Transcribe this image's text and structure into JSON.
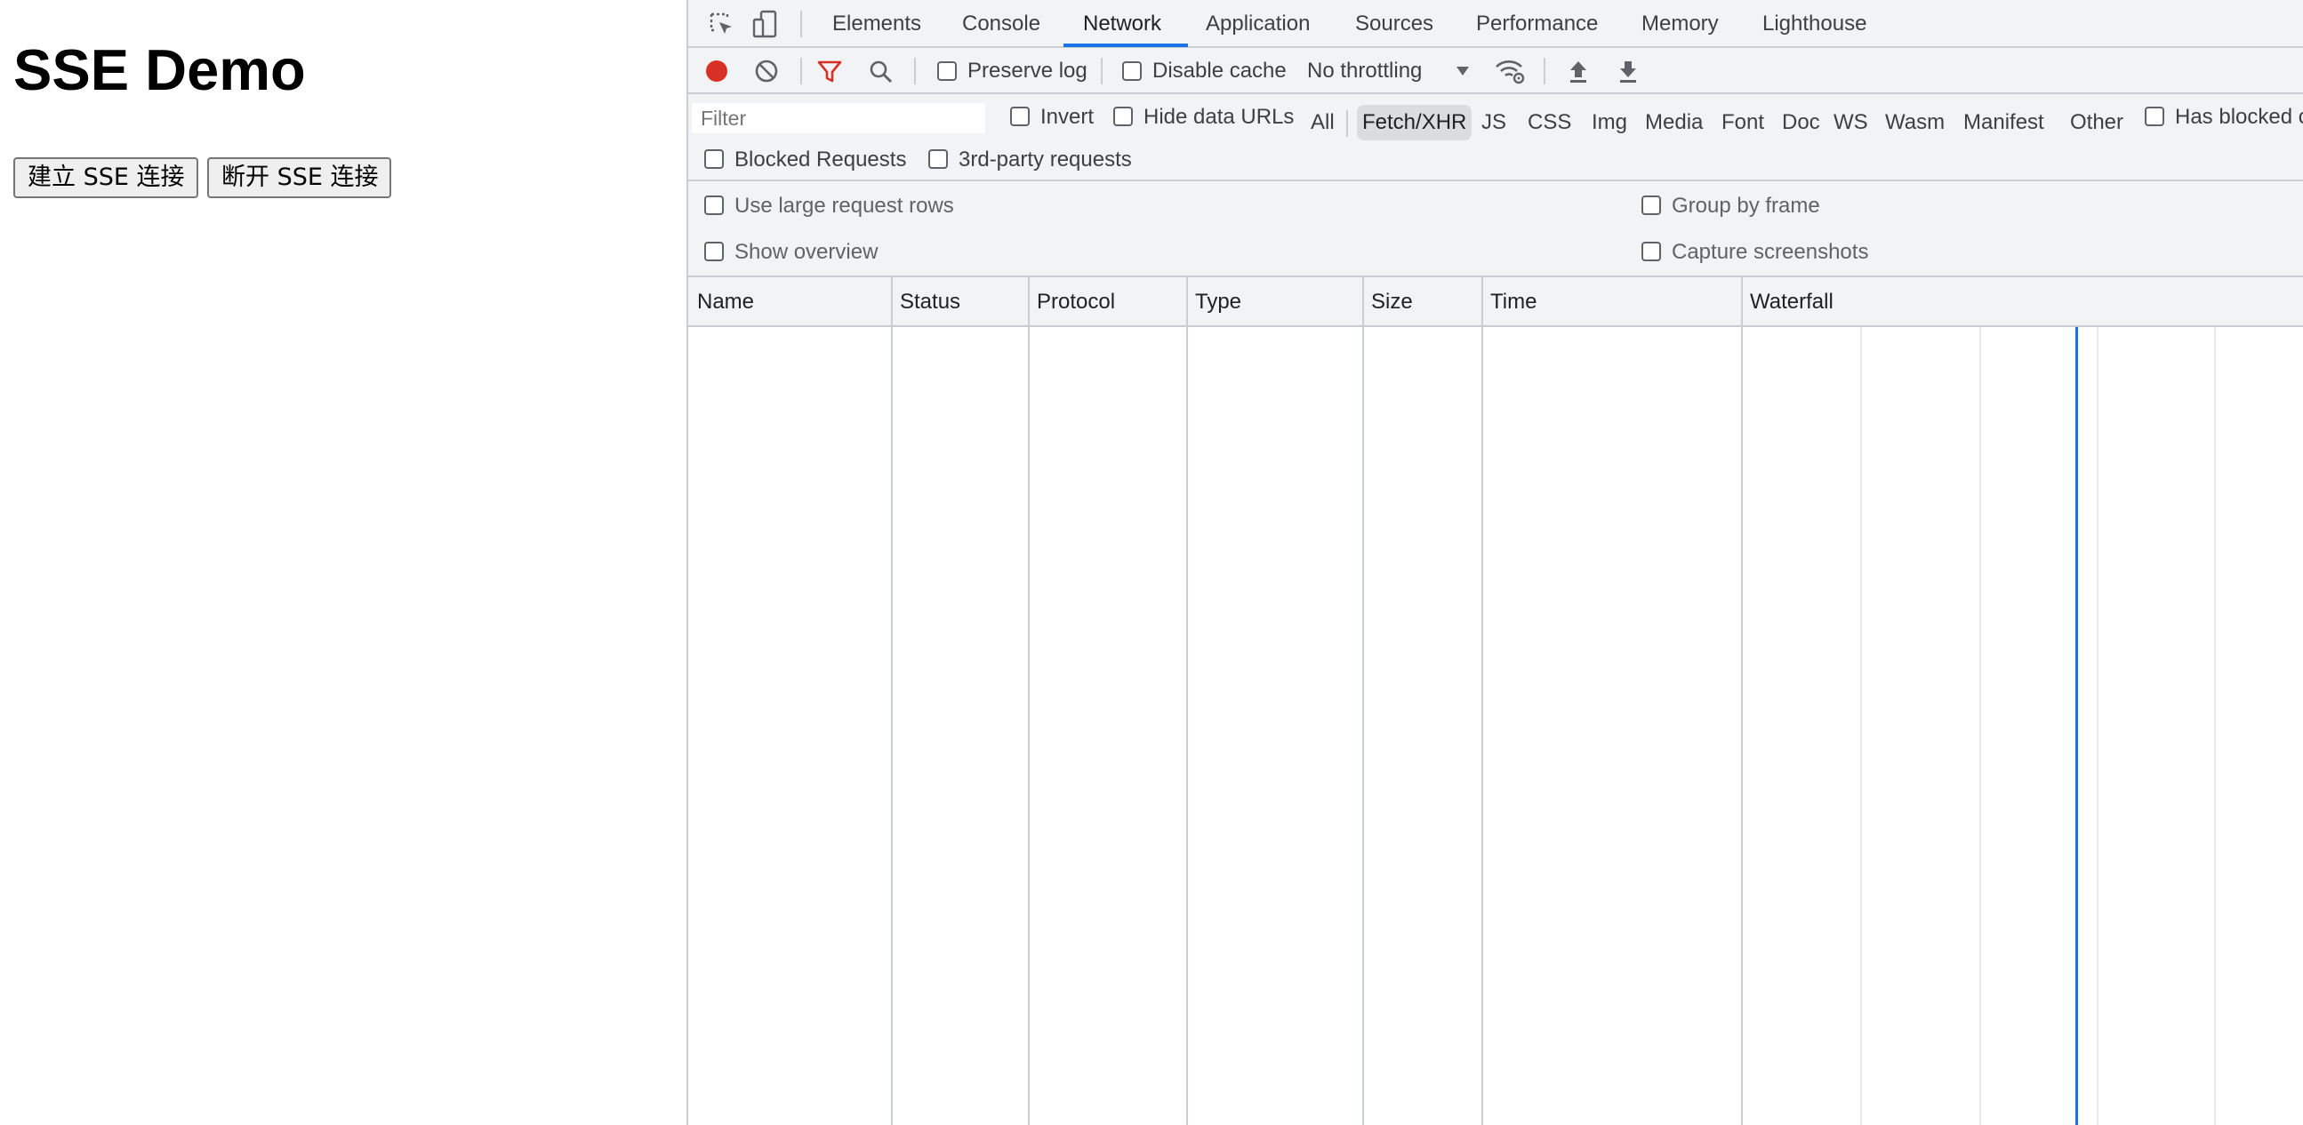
{
  "page": {
    "title": "SSE Demo",
    "connect_button": "建立 SSE 连接",
    "disconnect_button": "断开 SSE 连接"
  },
  "devtools": {
    "tabs": [
      {
        "label": "Elements",
        "active": false
      },
      {
        "label": "Console",
        "active": false
      },
      {
        "label": "Network",
        "active": true
      },
      {
        "label": "Application",
        "active": false
      },
      {
        "label": "Sources",
        "active": false
      },
      {
        "label": "Performance",
        "active": false
      },
      {
        "label": "Memory",
        "active": false
      },
      {
        "label": "Lighthouse",
        "active": false
      }
    ],
    "toolbar": {
      "preserve_log": "Preserve log",
      "disable_cache": "Disable cache",
      "throttling": "No throttling"
    },
    "filter": {
      "placeholder": "Filter",
      "invert": "Invert",
      "hide_data_urls": "Hide data URLs",
      "types": [
        "All",
        "Fetch/XHR",
        "JS",
        "CSS",
        "Img",
        "Media",
        "Font",
        "Doc",
        "WS",
        "Wasm",
        "Manifest",
        "Other"
      ],
      "active_type": "Fetch/XHR",
      "has_blocked": "Has blocked c",
      "blocked_requests": "Blocked Requests",
      "third_party": "3rd-party requests"
    },
    "settings": {
      "large_rows": "Use large request rows",
      "show_overview": "Show overview",
      "group_by_frame": "Group by frame",
      "capture_screenshots": "Capture screenshots"
    },
    "columns": [
      "Name",
      "Status",
      "Protocol",
      "Type",
      "Size",
      "Time",
      "Waterfall"
    ],
    "colors": {
      "accent": "#1a73e8",
      "record": "#d93025",
      "filter_active": "#d93025"
    }
  }
}
